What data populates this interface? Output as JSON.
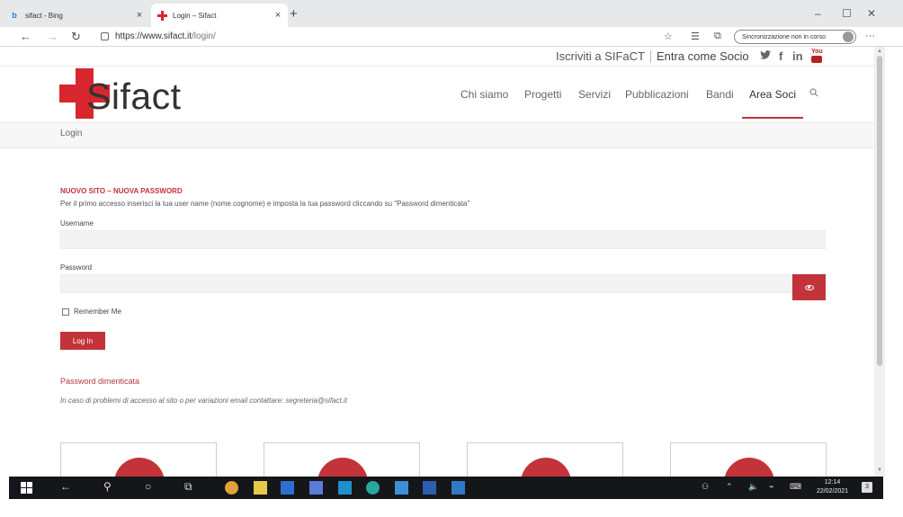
{
  "browser": {
    "tabs": [
      {
        "title": "sifact - Bing",
        "icon": "bing-icon",
        "active": false
      },
      {
        "title": "Login – Sifact",
        "icon": "sifact-cross-icon",
        "active": true
      }
    ],
    "new_tab": "+",
    "close_symbol": "×",
    "window_controls": {
      "minimize": "–",
      "maximize": "☐",
      "close": "✕"
    },
    "url_host": "https://www.sifact.it",
    "url_path": "/login/",
    "sync_label": "Sincronizzazione non in corso",
    "more": "···"
  },
  "site": {
    "top_links": {
      "signup": "Iscriviti a SIFaCT",
      "member": "Entra come Socio"
    },
    "social": {
      "twitter": "🐦",
      "facebook": "f",
      "linkedin": "in",
      "youtube": "You"
    },
    "logo_text": "Sifact",
    "nav": [
      "Chi siamo",
      "Progetti",
      "Servizi",
      "Pubblicazioni",
      "Bandi",
      "Area Soci"
    ],
    "active_nav": "Area Soci",
    "breadcrumb": "Login"
  },
  "login": {
    "notice_title": "NUOVO SITO – NUOVA PASSWORD",
    "notice_text": "Per il primo accesso inserisci la tua user name (nome.cognome) e imposta la tua password cliccando su \"Password dimenticata\"",
    "username_label": "Username",
    "username_value": "",
    "password_label": "Password",
    "password_value": "",
    "remember_label": "Remember Me",
    "remember_checked": false,
    "submit_label": "Log In",
    "forgot_link": "Password dimenticata",
    "help_text": "In caso di problemi di accesso al sito o per variazioni email contattare: segreteria@sifact.it"
  },
  "taskbar": {
    "time": "12:14",
    "date": "22/02/2021",
    "notifications": "3"
  },
  "colors": {
    "brand_red": "#c2343a",
    "logo_red": "#d8262f",
    "taskbar": "#15161a"
  }
}
